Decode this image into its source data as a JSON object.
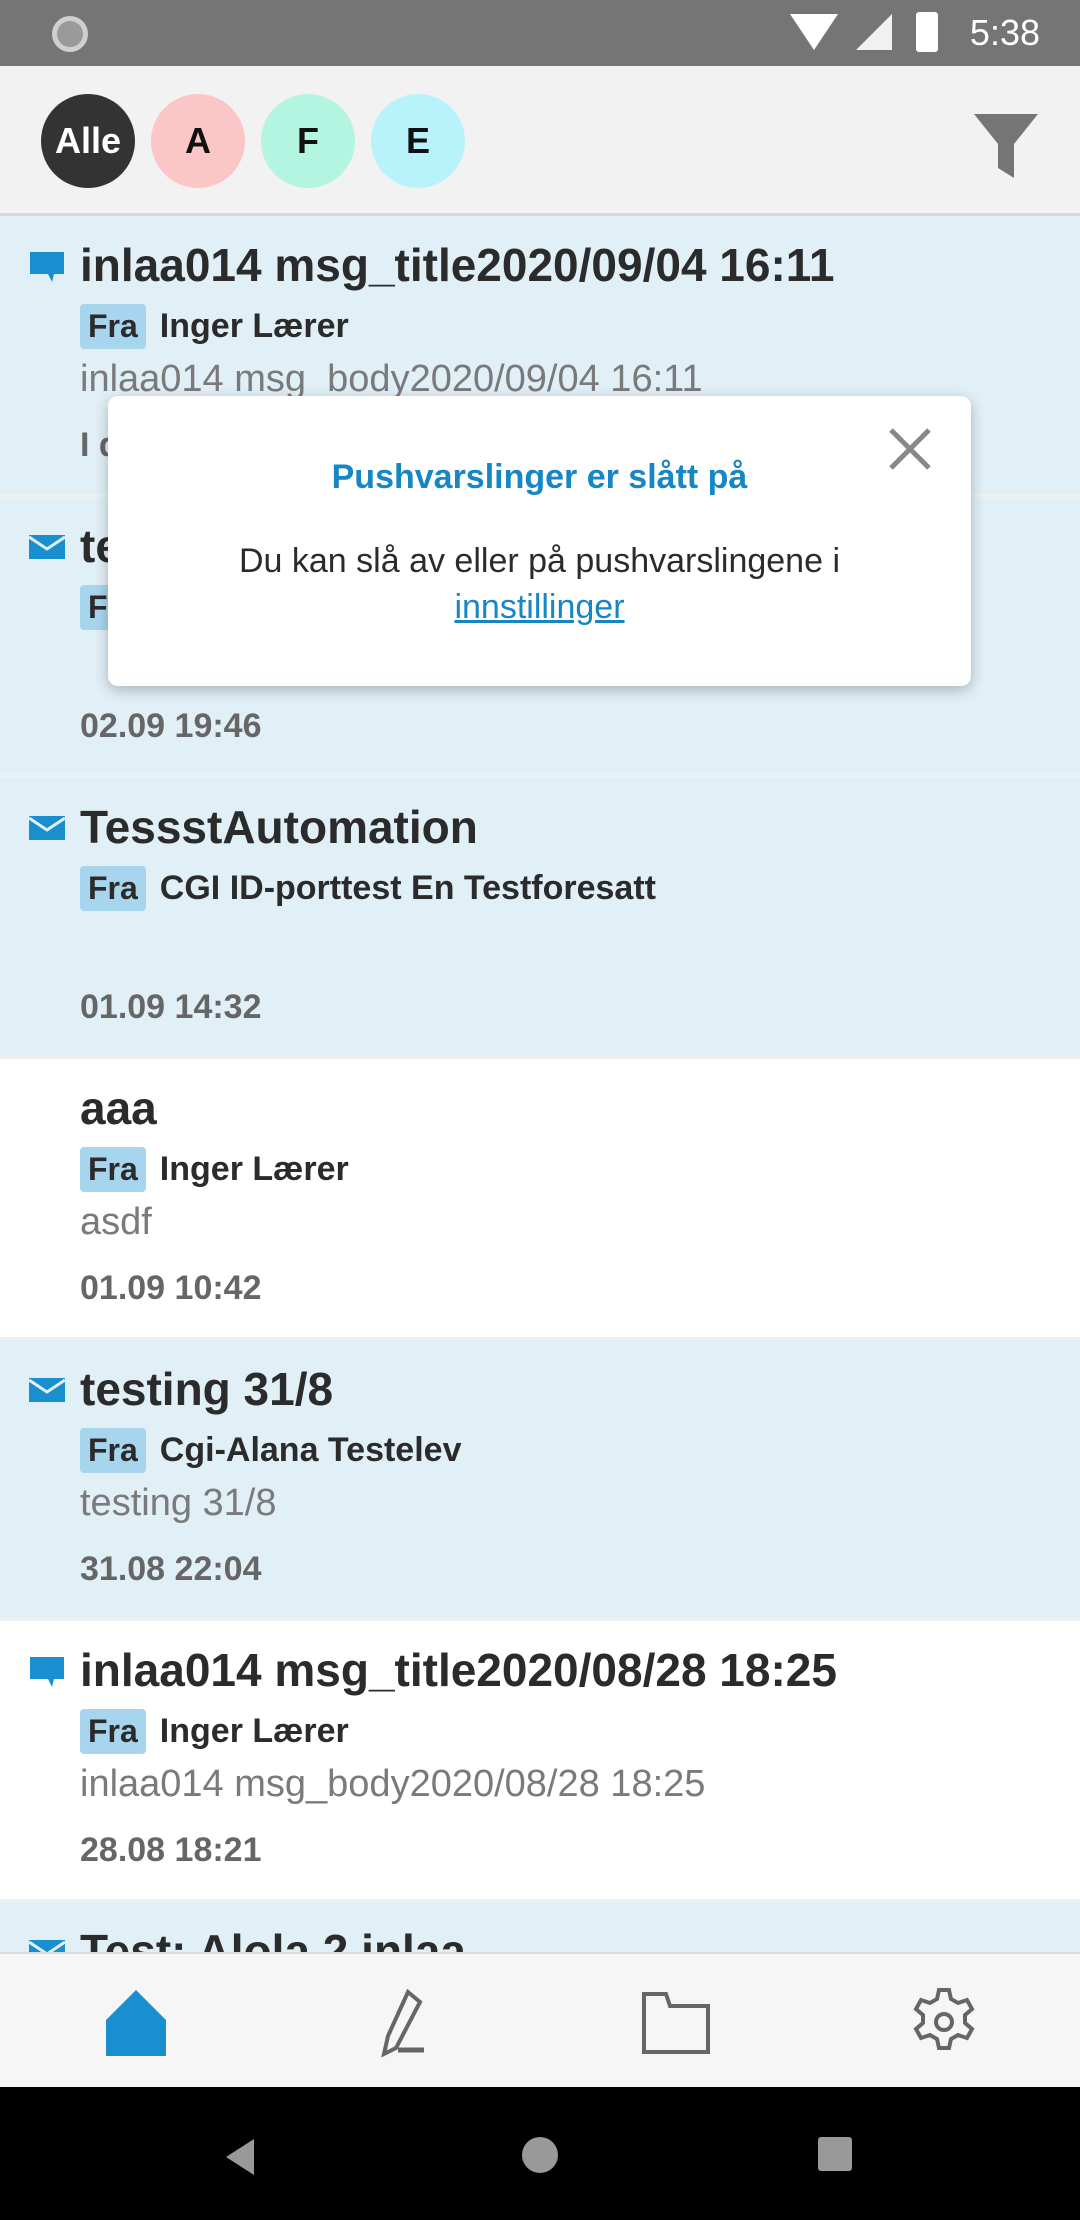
{
  "status_bar": {
    "time": "5:38"
  },
  "filters": [
    {
      "label": "Alle",
      "bg": "#333333",
      "fg": "#ffffff",
      "selected": true
    },
    {
      "label": "A",
      "bg": "#fbc6c6",
      "fg": "#111111"
    },
    {
      "label": "F",
      "bg": "#b3f5e0",
      "fg": "#111111"
    },
    {
      "label": "E",
      "bg": "#b8f3fb",
      "fg": "#111111"
    }
  ],
  "colors": {
    "accent": "#1a8fd0",
    "unread_bg": "#e1eff7",
    "fra_bg": "#a8d5ee"
  },
  "messages": [
    {
      "icon": "chat-icon",
      "unread": true,
      "title": "inlaa014 msg_title2020/09/04 16:11",
      "fra": "Fra",
      "sender": "Inger Lærer",
      "body": "inlaa014 msg_body2020/09/04 16:11",
      "date": "I d"
    },
    {
      "icon": "envelope-icon",
      "unread": true,
      "title": "te",
      "fra": "F",
      "sender": "",
      "body": "",
      "date": "02.09 19:46"
    },
    {
      "icon": "envelope-icon",
      "unread": true,
      "title": "TessstAutomation",
      "fra": "Fra",
      "sender": "CGI ID-porttest En Testforesatt",
      "body": "",
      "date": "01.09 14:32"
    },
    {
      "icon": "",
      "unread": false,
      "title": "aaa",
      "fra": "Fra",
      "sender": "Inger Lærer",
      "body": "asdf",
      "date": "01.09 10:42"
    },
    {
      "icon": "envelope-icon",
      "unread": true,
      "title": "testing  31/8",
      "fra": "Fra",
      "sender": "Cgi-Alana Testelev",
      "body": "testing  31/8",
      "date": "31.08 22:04"
    },
    {
      "icon": "chat-icon",
      "unread": false,
      "title": "inlaa014 msg_title2020/08/28 18:25",
      "fra": "Fra",
      "sender": "Inger Lærer",
      "body": "inlaa014 msg_body2020/08/28 18:25",
      "date": "28.08 18:21"
    },
    {
      "icon": "envelope-icon",
      "unread": true,
      "title": "Test: Alola 2 inlaa",
      "fra": "",
      "sender": "",
      "body": "",
      "date": ""
    }
  ],
  "popup": {
    "title": "Pushvarslinger er slått på",
    "text": "Du kan slå av eller på pushvarslingene i",
    "link": "innstillinger"
  },
  "bottom_nav": [
    {
      "icon": "home-icon",
      "active": true
    },
    {
      "icon": "pen-icon"
    },
    {
      "icon": "folder-icon"
    },
    {
      "icon": "gear-icon"
    }
  ]
}
